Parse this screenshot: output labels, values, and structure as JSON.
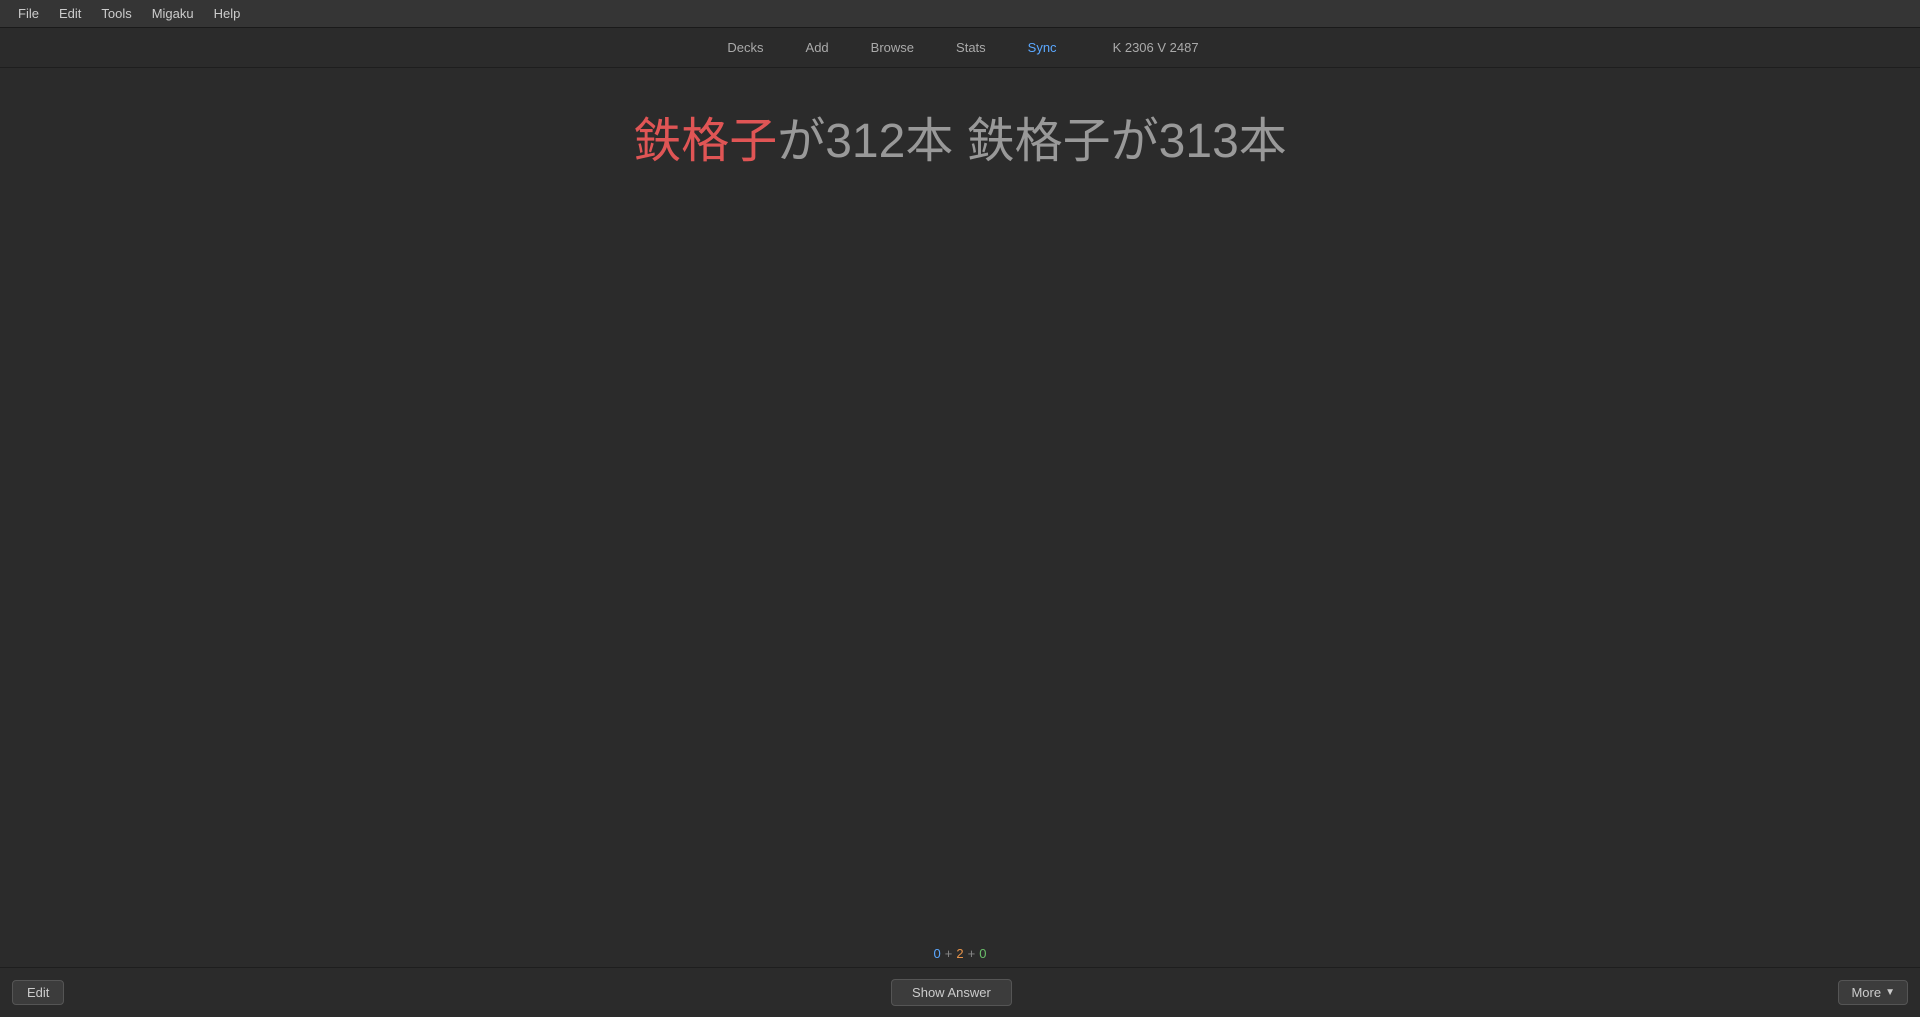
{
  "menubar": {
    "items": [
      {
        "label": "File",
        "id": "file"
      },
      {
        "label": "Edit",
        "id": "edit"
      },
      {
        "label": "Tools",
        "id": "tools"
      },
      {
        "label": "Migaku",
        "id": "migaku"
      },
      {
        "label": "Help",
        "id": "help"
      }
    ]
  },
  "navbar": {
    "items": [
      {
        "label": "Decks",
        "id": "decks",
        "active": false
      },
      {
        "label": "Add",
        "id": "add",
        "active": false
      },
      {
        "label": "Browse",
        "id": "browse",
        "active": false
      },
      {
        "label": "Stats",
        "id": "stats",
        "active": false
      },
      {
        "label": "Sync",
        "id": "sync",
        "active": true
      }
    ],
    "stats_display": "K 2306 V 2487"
  },
  "card": {
    "text_part1_kanji": "鉄格子",
    "text_part1_rest": "が312本",
    "text_part2": "鉄格子が313本"
  },
  "counter": {
    "blue_count": "0",
    "separator1": "+",
    "orange_count": "2",
    "separator2": "+",
    "green_count": "0"
  },
  "footer": {
    "edit_label": "Edit",
    "show_answer_label": "Show Answer",
    "more_label": "More",
    "chevron": "▼"
  }
}
